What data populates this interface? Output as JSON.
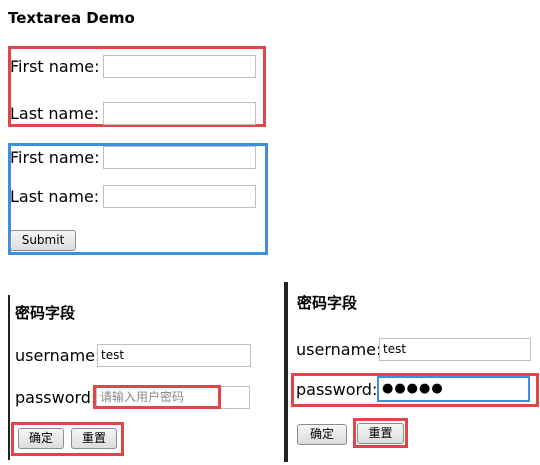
{
  "top": {
    "title": "Textarea Demo",
    "form1": {
      "first_label": "First name:",
      "last_label": "Last name:",
      "first_value": "",
      "last_value": ""
    },
    "form2": {
      "first_label": "First name:",
      "last_label": "Last name:",
      "first_value": "",
      "last_value": "",
      "submit_label": "Submit"
    }
  },
  "left_panel": {
    "title": "密码字段",
    "username_label": "username:",
    "username_value": "test",
    "password_label": "password:",
    "password_placeholder": "请输入用户密码",
    "confirm_label": "确定",
    "reset_label": "重置"
  },
  "right_panel": {
    "title": "密码字段",
    "username_label": "username:",
    "username_value": "test",
    "password_label": "password:",
    "password_masked": "●●●●●",
    "confirm_label": "确定",
    "reset_label": "重置"
  },
  "colors": {
    "highlight_red": "#e0454a",
    "highlight_blue": "#3b8fdc",
    "focus_blue": "#3f8fd8",
    "divider": "#222222"
  }
}
